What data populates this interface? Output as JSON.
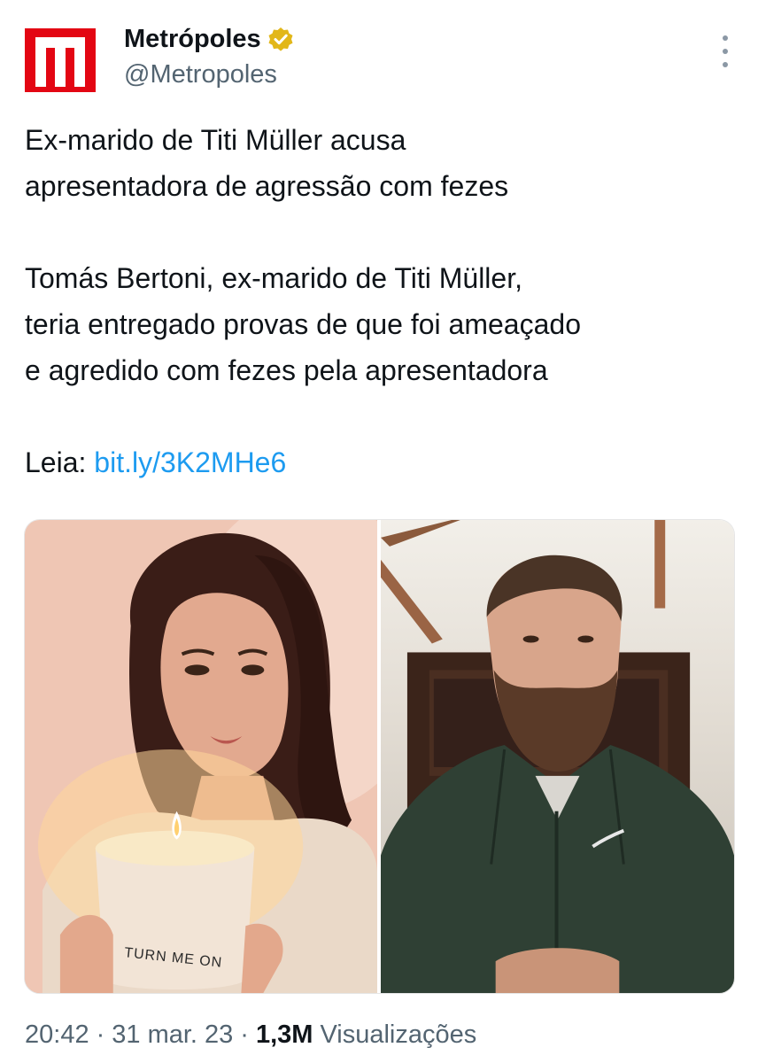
{
  "account": {
    "display_name": "Metrópoles",
    "handle": "@Metropoles",
    "avatar_letter": "M",
    "brand_color": "#e30613",
    "verified": true,
    "verified_color": "#e2b719"
  },
  "tweet": {
    "headline": "Ex-marido de Titi Müller acusa\napresentadora de agressão com fezes",
    "body": "Tomás Bertoni, ex-marido de Titi Müller,\nteria entregado provas de que foi ameaçado\ne agredido com fezes pela apresentadora",
    "read_prefix": "Leia: ",
    "link_text": "bit.ly/3K2MHe6",
    "link_color": "#1d9bf0"
  },
  "media": {
    "left_photo_icon": "woman-holding-candle",
    "right_photo_icon": "bearded-man-in-jacket",
    "candle_label": "TURN ME ON"
  },
  "meta": {
    "time": "20:42",
    "date": "31 mar. 23",
    "separator": "·",
    "views_count": "1,3M",
    "views_label": "Visualizações"
  },
  "icons": {
    "more": "more-options-icon",
    "verified": "verified-badge-icon"
  }
}
